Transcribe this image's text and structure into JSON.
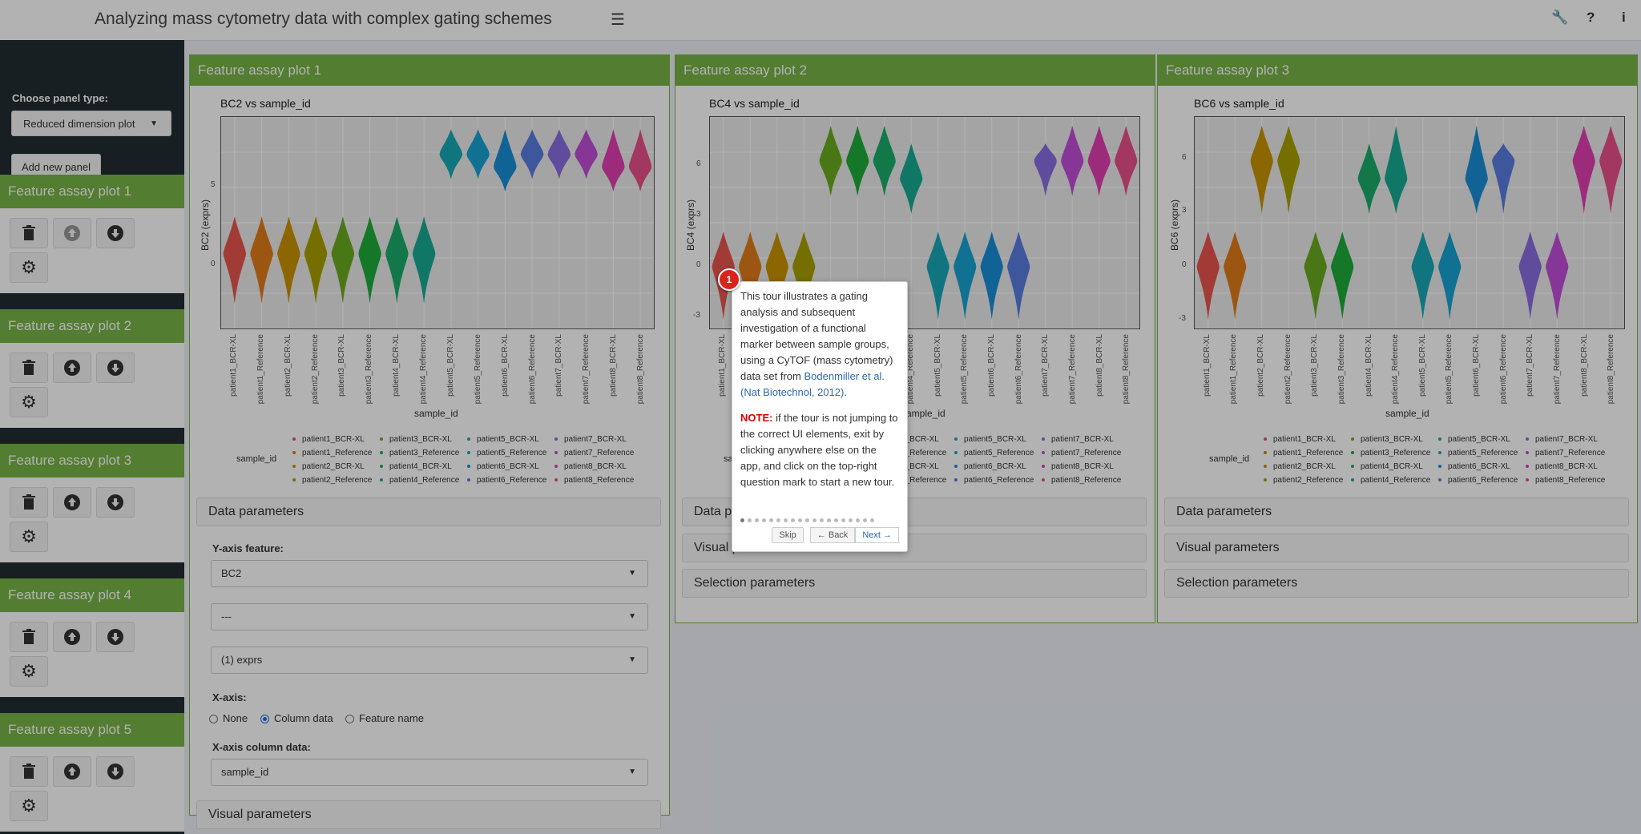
{
  "header": {
    "title": "Analyzing mass cytometry data with complex gating schemes",
    "icons": [
      "menu-icon",
      "wrench-icon",
      "help-icon",
      "info-icon"
    ]
  },
  "sidebar": {
    "panel_type_label": "Choose panel type:",
    "panel_type_value": "Reduced dimension plot",
    "add_panel_label": "Add new panel",
    "boxes": [
      {
        "title": "Feature assay plot 1"
      },
      {
        "title": "Feature assay plot 2"
      },
      {
        "title": "Feature assay plot 3"
      },
      {
        "title": "Feature assay plot 4"
      },
      {
        "title": "Feature assay plot 5"
      }
    ]
  },
  "panels": [
    {
      "title": "Feature assay plot 1",
      "plot_title": "BC2 vs sample_id",
      "ylabel": "BC2 (exprs)",
      "yticks": [
        "5",
        "0"
      ],
      "xlabel": "sample_id"
    },
    {
      "title": "Feature assay plot 2",
      "plot_title": "BC4 vs sample_id",
      "ylabel": "BC4 (exprs)",
      "yticks": [
        "6",
        "3",
        "0",
        "-3"
      ],
      "xlabel": "sample_id"
    },
    {
      "title": "Feature assay plot 3",
      "plot_title": "BC6 vs sample_id",
      "ylabel": "BC6 (exprs)",
      "yticks": [
        "6",
        "3",
        "0",
        "-3"
      ],
      "xlabel": "sample_id"
    }
  ],
  "sample_ids": [
    "patient1_BCR-XL",
    "patient1_Reference",
    "patient2_BCR-XL",
    "patient2_Reference",
    "patient3_BCR-XL",
    "patient3_Reference",
    "patient4_BCR-XL",
    "patient4_Reference",
    "patient5_BCR-XL",
    "patient5_Reference",
    "patient6_BCR-XL",
    "patient6_Reference",
    "patient7_BCR-XL",
    "patient7_Reference",
    "patient8_BCR-XL",
    "patient8_Reference"
  ],
  "sample_colors": [
    "#e8554e",
    "#e07b1a",
    "#c99200",
    "#a8a000",
    "#6aab1f",
    "#1fab3a",
    "#1aad6a",
    "#17ab94",
    "#17a8b5",
    "#18a2d2",
    "#1a8fd6",
    "#5a7be0",
    "#8a6de0",
    "#c04ed8",
    "#e040b0",
    "#e8508a"
  ],
  "legend": {
    "title": "sample_id",
    "columns": [
      [
        "patient1_BCR-XL",
        "patient1_Reference",
        "patient2_BCR-XL",
        "patient2_Reference"
      ],
      [
        "patient3_BCR-XL",
        "patient3_Reference",
        "patient4_BCR-XL",
        "patient4_Reference"
      ],
      [
        "patient5_BCR-XL",
        "patient5_Reference",
        "patient6_BCR-XL",
        "patient6_Reference"
      ],
      [
        "patient7_BCR-XL",
        "patient7_Reference",
        "patient8_BCR-XL",
        "patient8_Reference"
      ]
    ]
  },
  "sections": {
    "data": "Data parameters",
    "visual": "Visual parameters",
    "selection": "Selection parameters"
  },
  "data_params": {
    "yaxis_label": "Y-axis feature:",
    "yaxis_value": "BC2",
    "second_value": "---",
    "assay_value": "(1) exprs",
    "xaxis_label": "X-axis:",
    "xaxis_options": [
      "None",
      "Column data",
      "Feature name"
    ],
    "xaxis_selected": "Column data",
    "xcol_label": "X-axis column data:",
    "xcol_value": "sample_id"
  },
  "tour": {
    "step": "1",
    "text": "This tour illustrates a gating analysis and subsequent investigation of a functional marker between sample groups, using a CyTOF (mass cytometry) data set from ",
    "link": "Bodenmiller et al. (Nat Biotechnol, 2012)",
    "text_end": ".",
    "note_label": "NOTE:",
    "note_text": " if the tour is not jumping to the correct UI elements, exit by clicking anywhere else on the app, and click on the top-right question mark to start a new tour.",
    "skip": "Skip",
    "back": "← Back",
    "next": "Next →",
    "total_steps": 19,
    "current_step": 1
  },
  "chart_data": [
    {
      "type": "violin",
      "title": "BC2 vs sample_id",
      "xlabel": "sample_id",
      "ylabel": "BC2 (exprs)",
      "categories": [
        "patient1_BCR-XL",
        "patient1_Reference",
        "patient2_BCR-XL",
        "patient2_Reference",
        "patient3_BCR-XL",
        "patient3_Reference",
        "patient4_BCR-XL",
        "patient4_Reference",
        "patient5_BCR-XL",
        "patient5_Reference",
        "patient6_BCR-XL",
        "patient6_Reference",
        "patient7_BCR-XL",
        "patient7_Reference",
        "patient8_BCR-XL",
        "patient8_Reference"
      ],
      "centers": [
        0,
        0,
        0,
        0,
        0,
        0,
        0,
        0,
        8,
        8,
        7,
        8,
        8,
        8,
        7,
        7
      ],
      "ranges": [
        [
          -4,
          3
        ],
        [
          -4,
          3
        ],
        [
          -4,
          3
        ],
        [
          -4,
          3
        ],
        [
          -4,
          3
        ],
        [
          -4,
          3
        ],
        [
          -4,
          3
        ],
        [
          -4,
          3
        ],
        [
          6,
          10
        ],
        [
          6,
          10
        ],
        [
          5,
          10
        ],
        [
          6,
          10
        ],
        [
          6,
          10
        ],
        [
          6,
          10
        ],
        [
          5,
          10
        ],
        [
          5,
          10
        ]
      ],
      "ylim": [
        -6,
        11
      ]
    },
    {
      "type": "violin",
      "title": "BC4 vs sample_id",
      "xlabel": "sample_id",
      "ylabel": "BC4 (exprs)",
      "categories": [
        "patient1_BCR-XL",
        "patient1_Reference",
        "patient2_BCR-XL",
        "patient2_Reference",
        "patient3_BCR-XL",
        "patient3_Reference",
        "patient4_BCR-XL",
        "patient4_Reference",
        "patient5_BCR-XL",
        "patient5_Reference",
        "patient6_BCR-XL",
        "patient6_Reference",
        "patient7_BCR-XL",
        "patient7_Reference",
        "patient8_BCR-XL",
        "patient8_Reference"
      ],
      "centers": [
        0,
        0,
        0,
        0,
        6,
        6,
        6,
        5,
        0,
        0,
        0,
        0,
        6,
        6,
        6,
        6
      ],
      "ranges": [
        [
          -3,
          2
        ],
        [
          -3,
          2
        ],
        [
          -3,
          2
        ],
        [
          -3,
          2
        ],
        [
          4,
          8
        ],
        [
          4,
          8
        ],
        [
          4,
          8
        ],
        [
          3,
          7
        ],
        [
          -3,
          2
        ],
        [
          -3,
          2
        ],
        [
          -3,
          2
        ],
        [
          -3,
          2
        ],
        [
          4,
          7
        ],
        [
          4,
          8
        ],
        [
          4,
          8
        ],
        [
          4,
          8
        ]
      ],
      "ylim": [
        -3.5,
        8.5
      ]
    },
    {
      "type": "violin",
      "title": "BC6 vs sample_id",
      "xlabel": "sample_id",
      "ylabel": "BC6 (exprs)",
      "categories": [
        "patient1_BCR-XL",
        "patient1_Reference",
        "patient2_BCR-XL",
        "patient2_Reference",
        "patient3_BCR-XL",
        "patient3_Reference",
        "patient4_BCR-XL",
        "patient4_Reference",
        "patient5_BCR-XL",
        "patient5_Reference",
        "patient6_BCR-XL",
        "patient6_Reference",
        "patient7_BCR-XL",
        "patient7_Reference",
        "patient8_BCR-XL",
        "patient8_Reference"
      ],
      "centers": [
        0,
        0,
        6,
        6,
        0,
        0,
        5,
        5,
        0,
        0,
        5,
        6,
        0,
        0,
        6,
        6
      ],
      "ranges": [
        [
          -3,
          2
        ],
        [
          -3,
          2
        ],
        [
          3,
          8
        ],
        [
          3,
          8
        ],
        [
          -3,
          2
        ],
        [
          -3,
          2
        ],
        [
          3,
          7
        ],
        [
          3,
          8
        ],
        [
          -3,
          2
        ],
        [
          -3,
          2
        ],
        [
          3,
          8
        ],
        [
          3,
          7
        ],
        [
          -3,
          2
        ],
        [
          -3,
          2
        ],
        [
          3,
          8
        ],
        [
          3,
          8
        ]
      ],
      "ylim": [
        -3.5,
        8.5
      ]
    }
  ]
}
